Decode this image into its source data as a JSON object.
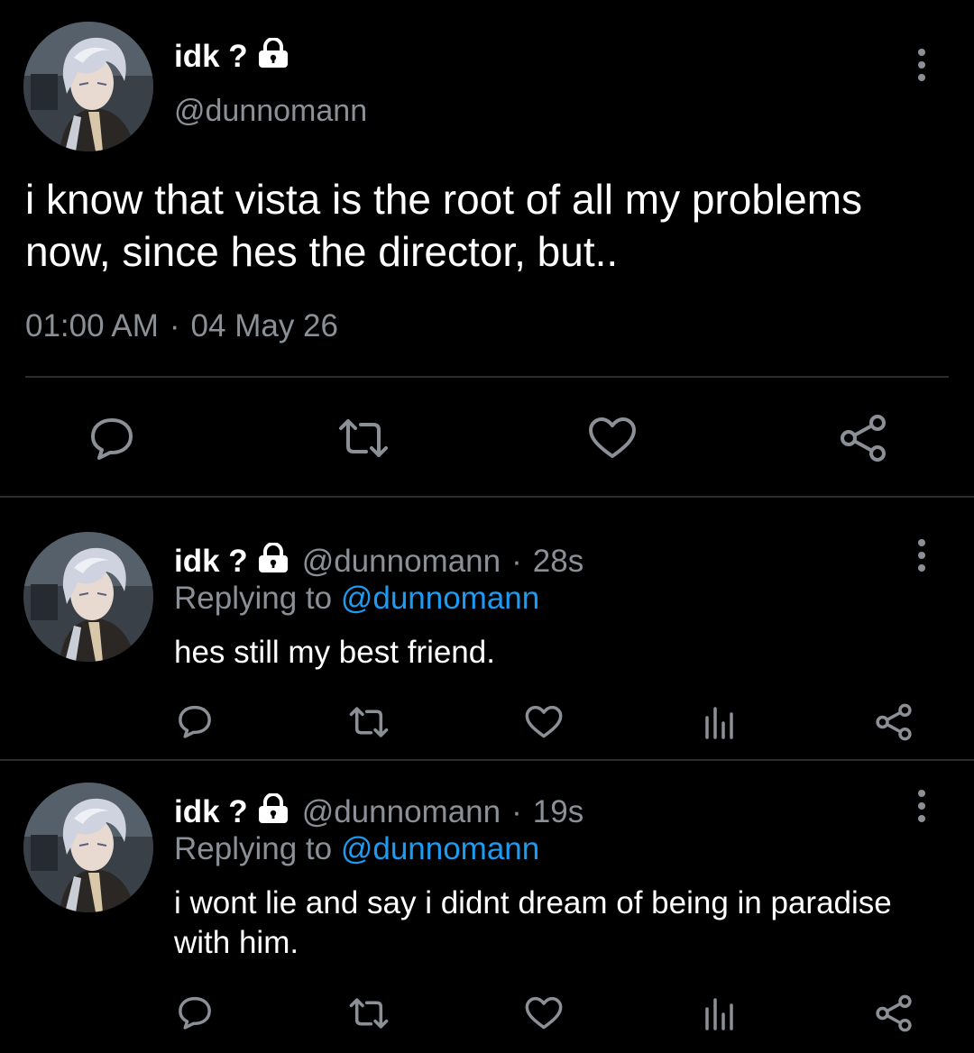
{
  "main_tweet": {
    "display_name": "idk ?",
    "handle": "@dunnomann",
    "text": "i know that vista is the root of all my problems now, since hes the director, but..",
    "time": "01:00 AM",
    "separator": "·",
    "date": "04 May 26",
    "actions": [
      "reply-icon",
      "retweet-icon",
      "like-icon",
      "share-icon"
    ]
  },
  "replies": [
    {
      "display_name": "idk ?",
      "handle": "@dunnomann",
      "separator": "·",
      "time_ago": "28s",
      "replying_prefix": "Replying to ",
      "replying_to": "@dunnomann",
      "text": "hes still my best friend.",
      "actions": [
        "reply-icon",
        "retweet-icon",
        "like-icon",
        "analytics-icon",
        "share-icon"
      ]
    },
    {
      "display_name": "idk ?",
      "handle": "@dunnomann",
      "separator": "·",
      "time_ago": "19s",
      "replying_prefix": "Replying to ",
      "replying_to": "@dunnomann",
      "text": "i wont lie and say i didnt dream of being in paradise with him.",
      "actions": [
        "reply-icon",
        "retweet-icon",
        "like-icon",
        "analytics-icon",
        "share-icon"
      ]
    }
  ],
  "colors": {
    "background": "#000000",
    "text": "#ffffff",
    "secondary_text": "#8b9096",
    "mention": "#1d9bf0",
    "divider": "#2a2d30"
  }
}
